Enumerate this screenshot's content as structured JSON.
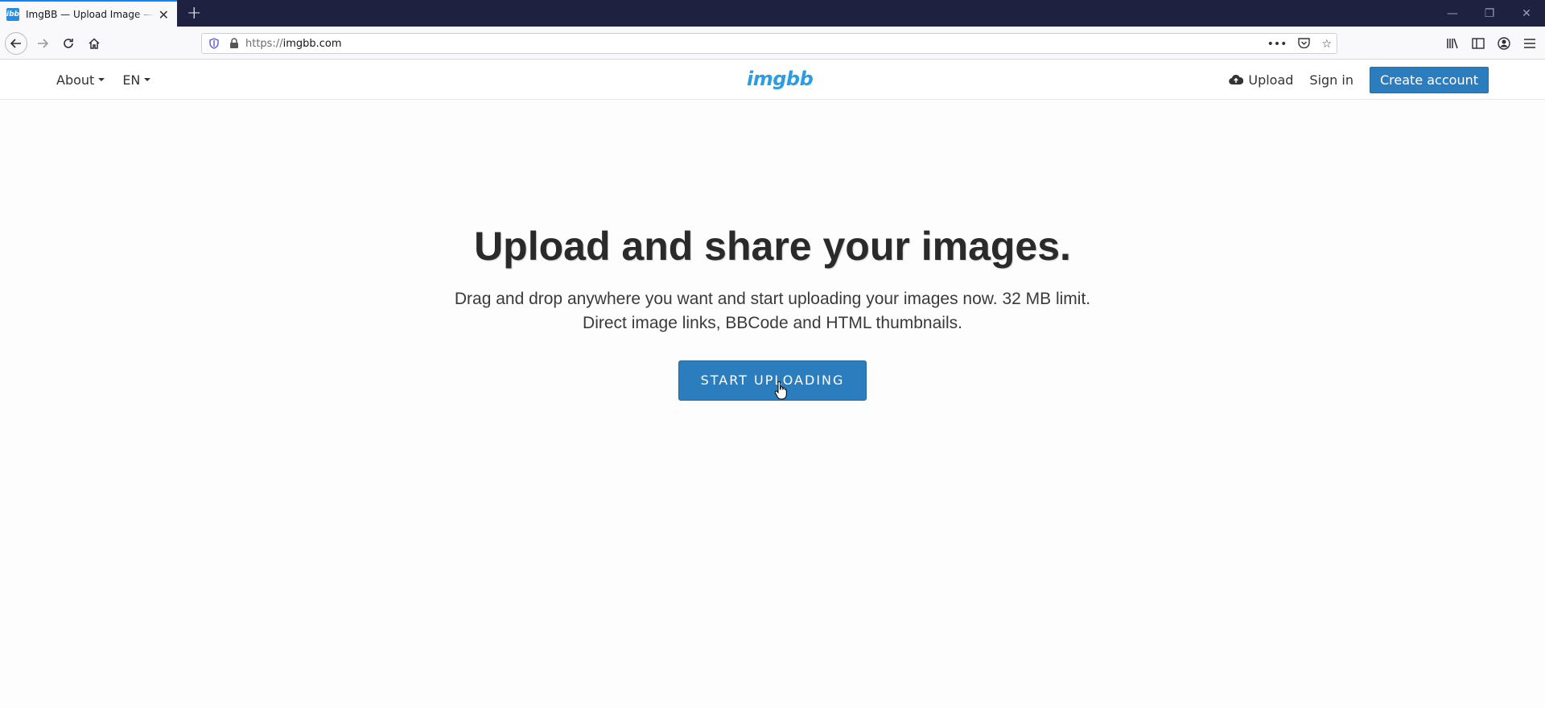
{
  "browser": {
    "tab_title": "ImgBB — Upload Image — Free",
    "favicon_text": "ibb",
    "url_scheme": "https://",
    "url_host": "imgbb.com",
    "new_tab_glyph": "+"
  },
  "icons": {
    "back": "back-arrow-icon",
    "forward": "forward-arrow-icon",
    "reload": "reload-icon",
    "home": "home-icon",
    "tracking": "shield-icon",
    "lock": "lock-icon",
    "page_actions": "more-icon",
    "pocket": "pocket-icon",
    "bookmark": "star-icon",
    "library": "library-icon",
    "sidebar": "sidebar-icon",
    "account": "account-icon",
    "menu": "hamburger-icon",
    "upload": "cloud-upload-icon"
  },
  "header": {
    "about_label": "About",
    "lang_label": "EN",
    "logo_text": "imgbb",
    "upload_label": "Upload",
    "signin_label": "Sign in",
    "create_label": "Create account"
  },
  "hero": {
    "title": "Upload and share your images.",
    "description": "Drag and drop anywhere you want and start uploading your images now. 32 MB limit. Direct image links, BBCode and HTML thumbnails.",
    "cta_label": "START UPLOADING"
  },
  "colors": {
    "accent": "#2c7dbe",
    "logo": "#2a9ee4",
    "titlebar": "#1f2140"
  }
}
